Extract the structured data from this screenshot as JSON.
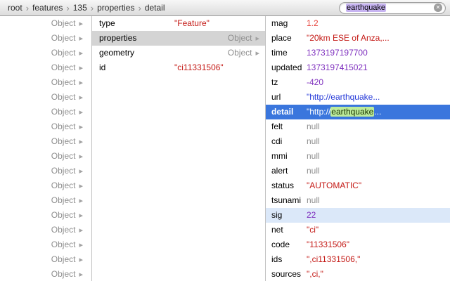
{
  "breadcrumb": {
    "items": [
      "root",
      "features",
      "135",
      "properties",
      "detail"
    ]
  },
  "search": {
    "value": "earthquake"
  },
  "icons": {
    "disclosure": "▸",
    "clear": "✕",
    "crumb_separator": "›"
  },
  "left_panel": {
    "rows": [
      {
        "label": "Object"
      },
      {
        "label": "Object"
      },
      {
        "label": "Object"
      },
      {
        "label": "Object"
      },
      {
        "label": "Object"
      },
      {
        "label": "Object"
      },
      {
        "label": "Object"
      },
      {
        "label": "Object"
      },
      {
        "label": "Object"
      },
      {
        "label": "Object"
      },
      {
        "label": "Object"
      },
      {
        "label": "Object"
      },
      {
        "label": "Object"
      },
      {
        "label": "Object"
      },
      {
        "label": "Object"
      },
      {
        "label": "Object"
      },
      {
        "label": "Object"
      },
      {
        "label": "Object"
      }
    ]
  },
  "middle_panel": {
    "rows": [
      {
        "key": "type",
        "value": "\"Feature\"",
        "kind": "string"
      },
      {
        "key": "properties",
        "value": "Object",
        "kind": "object",
        "selected": true
      },
      {
        "key": "geometry",
        "value": "Object",
        "kind": "object"
      },
      {
        "key": "id",
        "value": "\"ci11331506\"",
        "kind": "string"
      }
    ]
  },
  "right_panel": {
    "rows": [
      {
        "key": "mag",
        "value": "1.2",
        "kind": "float"
      },
      {
        "key": "place",
        "value": "\"20km ESE of Anza,...",
        "kind": "string"
      },
      {
        "key": "time",
        "value": "1373197197700",
        "kind": "number"
      },
      {
        "key": "updated",
        "value": "1373197415021",
        "kind": "number"
      },
      {
        "key": "tz",
        "value": "-420",
        "kind": "number"
      },
      {
        "key": "url",
        "value": "\"http://earthquake...",
        "kind": "url"
      },
      {
        "key": "detail",
        "kind": "selected",
        "value_parts": {
          "prefix": "\"http://",
          "match": "earthquake",
          "suffix": "..."
        }
      },
      {
        "key": "felt",
        "value": "null",
        "kind": "null"
      },
      {
        "key": "cdi",
        "value": "null",
        "kind": "null"
      },
      {
        "key": "mmi",
        "value": "null",
        "kind": "null"
      },
      {
        "key": "alert",
        "value": "null",
        "kind": "null"
      },
      {
        "key": "status",
        "value": "\"AUTOMATIC\"",
        "kind": "string"
      },
      {
        "key": "tsunami",
        "value": "null",
        "kind": "null"
      },
      {
        "key": "sig",
        "value": "22",
        "kind": "number",
        "row_highlight": true
      },
      {
        "key": "net",
        "value": "\"ci\"",
        "kind": "string"
      },
      {
        "key": "code",
        "value": "\"11331506\"",
        "kind": "string"
      },
      {
        "key": "ids",
        "value": "\",ci11331506,\"",
        "kind": "string"
      },
      {
        "key": "sources",
        "value": "\",ci,\"",
        "kind": "string"
      }
    ]
  },
  "colors": {
    "selection_blue": "#3a76dd",
    "inactive_selection_grey": "#d4d4d4",
    "row_tint_blue": "#dbe8f9",
    "search_highlight_purple": "#c7b4f1",
    "match_highlight_green": "#bdeb9b",
    "string_red": "#c41a16",
    "number_purple": "#7e2fbe",
    "null_grey": "#8e8e8e",
    "url_blue": "#2438d8"
  }
}
